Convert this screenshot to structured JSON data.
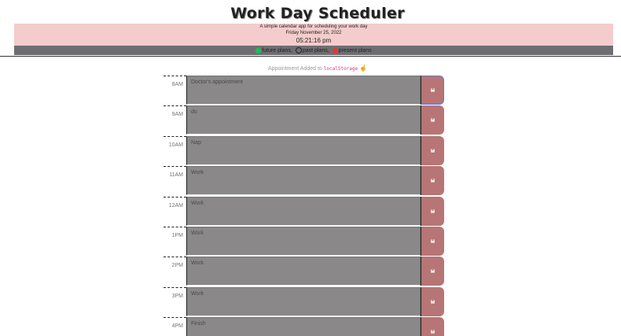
{
  "header": {
    "title": "Work Day Scheduler",
    "subtitle": "A simple calendar app for scheduling your work day",
    "date": "Friday November 25, 2022",
    "clock": "05:21:16 pm"
  },
  "legend": {
    "future": "future plans,",
    "past": "past plans,",
    "present": "present plans"
  },
  "notice": {
    "prefix": "Appointment Added to",
    "code": "localStorage",
    "emoji": "☝"
  },
  "colors": {
    "jumbotron": "#f4cccc",
    "legend_bar": "#6e6e72",
    "future": "#19c15a",
    "present": "#e8352f",
    "textarea": "#8a8889",
    "save_button": "#b77575"
  },
  "icons": {
    "save": "floppy-disk-icon"
  },
  "hours": [
    {
      "hour": "8AM",
      "text": "Doctor's appointment"
    },
    {
      "hour": "9AM",
      "text": "do"
    },
    {
      "hour": "10AM",
      "text": "Nap"
    },
    {
      "hour": "11AM",
      "text": "Work"
    },
    {
      "hour": "12AM",
      "text": "Work"
    },
    {
      "hour": "1PM",
      "text": "Work"
    },
    {
      "hour": "2PM",
      "text": "Work"
    },
    {
      "hour": "3PM",
      "text": "Work"
    },
    {
      "hour": "4PM",
      "text": "Finish"
    }
  ]
}
